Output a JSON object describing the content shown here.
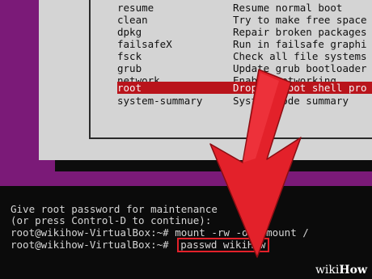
{
  "recovery_menu": {
    "items": [
      {
        "name": "resume",
        "desc": "Resume normal boot"
      },
      {
        "name": "clean",
        "desc": "Try to make free space"
      },
      {
        "name": "dpkg",
        "desc": "Repair broken packages"
      },
      {
        "name": "failsafeX",
        "desc": "Run in failsafe graphi"
      },
      {
        "name": "fsck",
        "desc": "Check all file systems"
      },
      {
        "name": "grub",
        "desc": "Update grub bootloader"
      },
      {
        "name": "network",
        "desc": "Enable networking"
      },
      {
        "name": "root",
        "desc": "Drop to root shell pro"
      },
      {
        "name": "system-summary",
        "desc": "System mode summary"
      }
    ],
    "selected_index": 7
  },
  "terminal": {
    "line1": "Give root password for maintenance",
    "line2": "(or press Control-D to continue):",
    "line3_prompt": "root@wikihow-VirtualBox:~# ",
    "line3_cmd": "mount -rw -o remount /",
    "line4_prompt": "root@wikihow-VirtualBox:~# ",
    "line4_cmd": "passwd wikiHow"
  },
  "watermark": {
    "part1": "wiki",
    "part2": "How"
  },
  "colors": {
    "background": "#7b1a78",
    "selection": "#b9141b",
    "arrow": "#e3212a",
    "highlight_box": "#e3212a"
  }
}
